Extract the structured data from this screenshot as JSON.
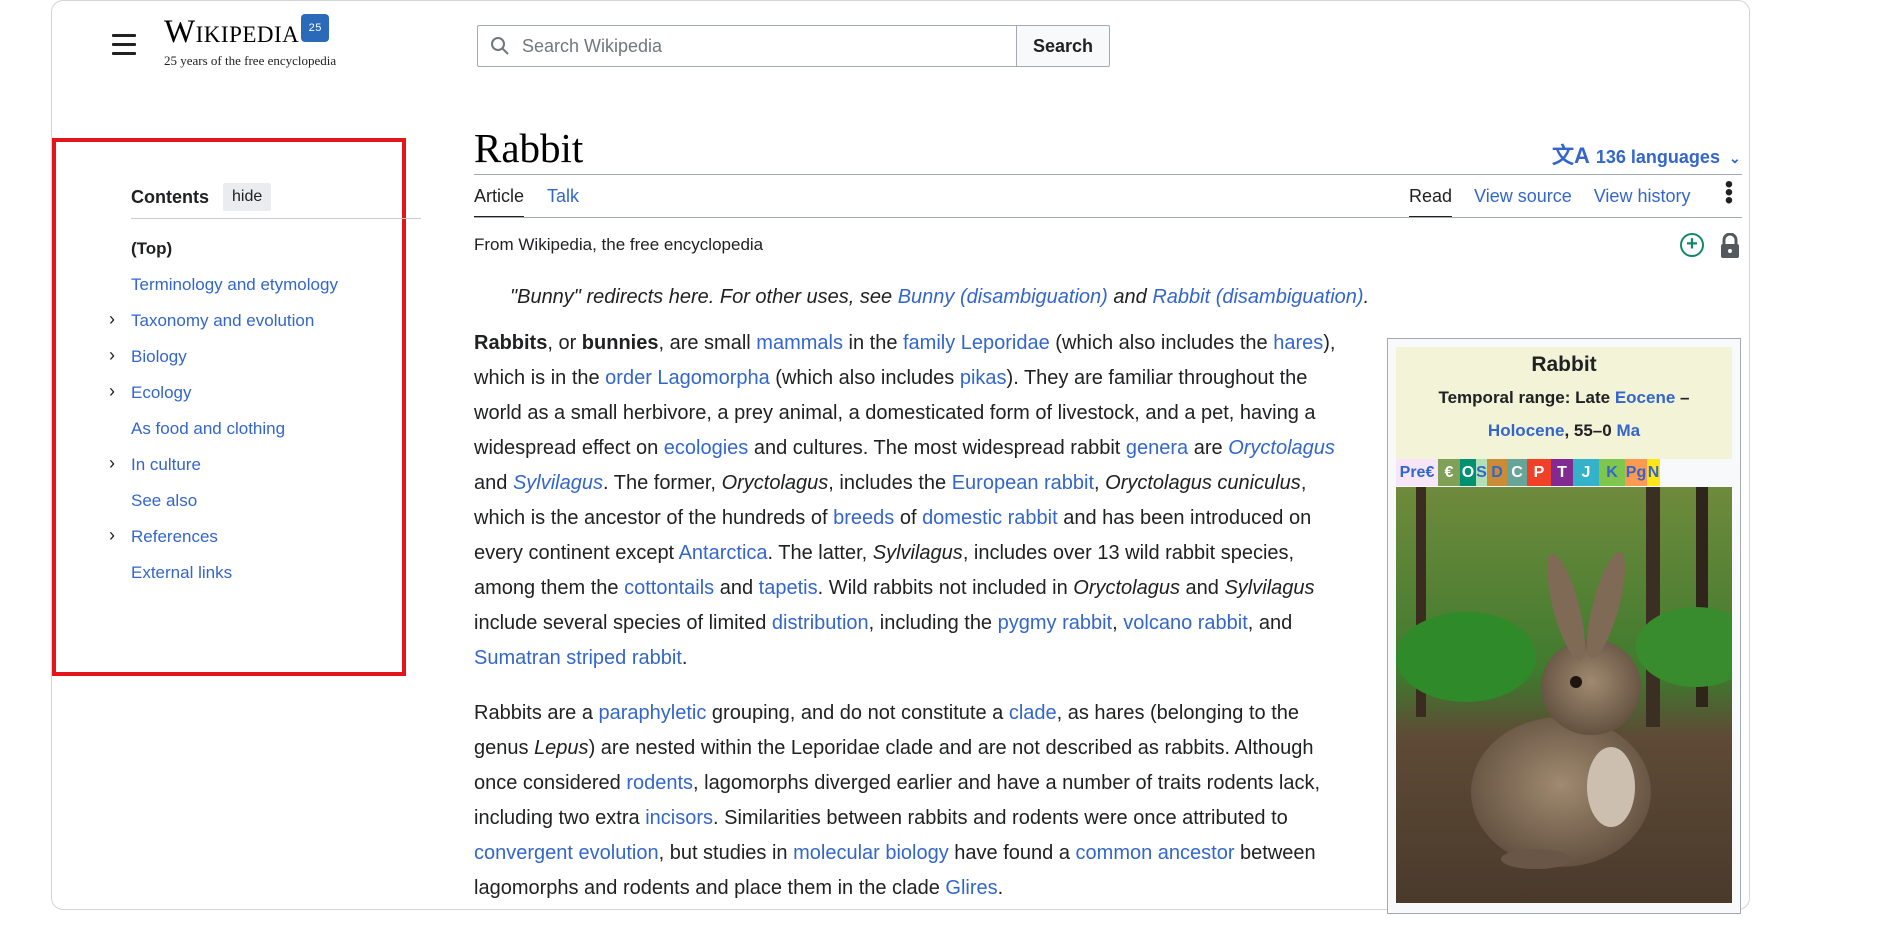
{
  "header": {
    "logo_word": "Wikipedia",
    "logo_badge": "25",
    "logo_tagline": "25 years of the free encyclopedia",
    "search_placeholder": "Search Wikipedia",
    "search_button": "Search"
  },
  "toc": {
    "title": "Contents",
    "hide_label": "hide",
    "items": [
      {
        "label": "(Top)",
        "expandable": false
      },
      {
        "label": "Terminology and etymology",
        "expandable": false
      },
      {
        "label": "Taxonomy and evolution",
        "expandable": true
      },
      {
        "label": "Biology",
        "expandable": true
      },
      {
        "label": "Ecology",
        "expandable": true
      },
      {
        "label": "As food and clothing",
        "expandable": false
      },
      {
        "label": "In culture",
        "expandable": true
      },
      {
        "label": "See also",
        "expandable": false
      },
      {
        "label": "References",
        "expandable": true
      },
      {
        "label": "External links",
        "expandable": false
      }
    ]
  },
  "article": {
    "title": "Rabbit",
    "languages": "136 languages",
    "tabs_left": [
      "Article",
      "Talk"
    ],
    "tabs_right": [
      "Read",
      "View source",
      "View history"
    ],
    "from": "From Wikipedia, the free encyclopedia",
    "hatnote": {
      "pre": "\"Bunny\" redirects here. For other uses, see ",
      "link1": "Bunny (disambiguation)",
      "mid": " and ",
      "link2": "Rabbit (disambiguation)",
      "post": "."
    }
  },
  "infobox": {
    "name": "Rabbit",
    "range_pre": "Temporal range: Late ",
    "range_link1": "Eocene",
    "range_dash": " –",
    "range_link2": "Holocene",
    "range_post": ", 55–0 ",
    "range_link3": "Ma",
    "periods": [
      {
        "label": "Pre€",
        "color": "#f7e6f7",
        "text": "#3366cc"
      },
      {
        "label": "€",
        "color": "#7fa056",
        "text": "#ffffff"
      },
      {
        "label": "O",
        "color": "#009270",
        "text": "#ffffff"
      },
      {
        "label": "S",
        "color": "#b3e1b6",
        "text": "#3366cc"
      },
      {
        "label": "D",
        "color": "#cb8c37",
        "text": "#3366cc"
      },
      {
        "label": "C",
        "color": "#67a599",
        "text": "#ffffff"
      },
      {
        "label": "P",
        "color": "#f04028",
        "text": "#ffffff"
      },
      {
        "label": "T",
        "color": "#812b92",
        "text": "#ffffff"
      },
      {
        "label": "J",
        "color": "#34b2c9",
        "text": "#ffffff"
      },
      {
        "label": "K",
        "color": "#7fc64e",
        "text": "#3366cc"
      },
      {
        "label": "Pg",
        "color": "#fd9a52",
        "text": "#3366cc"
      },
      {
        "label": "N",
        "color": "#ffe619",
        "text": "#3366cc"
      }
    ]
  },
  "colors": {
    "link": "#3366cc",
    "highlight": "#e4141b"
  }
}
